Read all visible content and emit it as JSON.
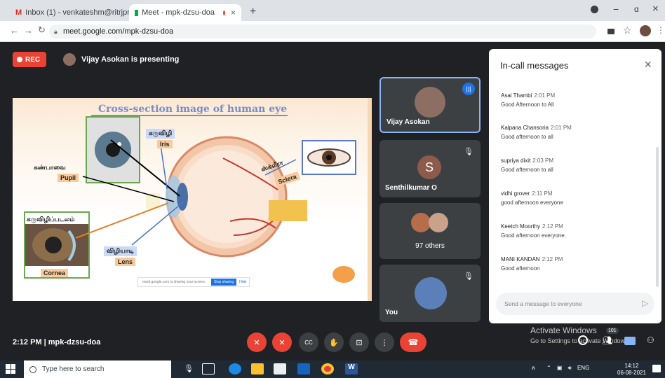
{
  "browser": {
    "tabs": [
      {
        "label": "Inbox (1) - venkateshm@ritrjpm.",
        "close": "×"
      },
      {
        "label": "Meet - mpk-dzsu-doa",
        "close": "×"
      }
    ],
    "new_tab": "+",
    "url": "meet.google.com/mpk-dzsu-doa",
    "window_controls": {
      "minimize": "−",
      "maximize": "ɑ",
      "close": "×"
    }
  },
  "meet": {
    "rec_label": "REC",
    "presenting_text": "Vijay Asokan is presenting",
    "slide": {
      "title": "Cross-section image of human eye",
      "labels": {
        "iris_ta": "கருவிழி",
        "iris": "Iris",
        "pupil_ta": "கண்பாவை",
        "pupil": "Pupil",
        "sclera_ta": "ஸ்க்லீரா",
        "sclera": "Sclera",
        "cornea_ta": "கருவிழிப்படலம்",
        "cornea": "Cornea",
        "lens_ta": "விழியாடி",
        "lens": "Lens"
      },
      "share_bar_text": "meet.google.com is sharing your screen.",
      "stop_sharing": "Stop sharing",
      "hide": "Hide"
    },
    "tiles": [
      {
        "name": "Vijay Asokan",
        "initial": ""
      },
      {
        "name": "Senthilkumar O",
        "initial": "S"
      },
      {
        "name": "97 others",
        "initial": ""
      },
      {
        "name": "You",
        "initial": ""
      }
    ],
    "chat": {
      "title": "In-call messages",
      "close": "×",
      "messages": [
        {
          "sender": "Asai Thambi",
          "time": "2:01 PM",
          "text": "Good  Afternoon to All"
        },
        {
          "sender": "Kalpana Chansoria",
          "time": "2:01 PM",
          "text": "Good afternoon to all"
        },
        {
          "sender": "supriya dixit",
          "time": "2:03 PM",
          "text": "Good afternoon to all"
        },
        {
          "sender": "vidhi grover",
          "time": "2:11 PM",
          "text": "good afternoon everyone"
        },
        {
          "sender": "Keetch Moorthy",
          "time": "2:12 PM",
          "text": "Good afternoon everyone."
        },
        {
          "sender": "MANI KANDAN",
          "time": "2:12 PM",
          "text": "Good afternoon"
        }
      ],
      "input_placeholder": "Send a message to everyone",
      "send": "▷"
    },
    "meeting_info": "2:12 PM  |  mpk-dzsu-doa",
    "controls": {
      "mic": "✕",
      "cam": "✕",
      "cc": "CC",
      "hand": "✋",
      "present": "⊡",
      "more": "⋮",
      "leave": "☎"
    },
    "activate_line1": "Activate Windows",
    "activate_line2": "Go to Settings to activate Windows.",
    "participant_count": "101"
  },
  "taskbar": {
    "search_placeholder": "Type here to search",
    "lang": "ENG",
    "time": "14:12",
    "date": "06-08-2021"
  },
  "colors": {
    "meet_bg": "#202124",
    "tile_bg": "#3c4043",
    "red": "#ea4335",
    "accent_blue": "#1a73e8"
  }
}
